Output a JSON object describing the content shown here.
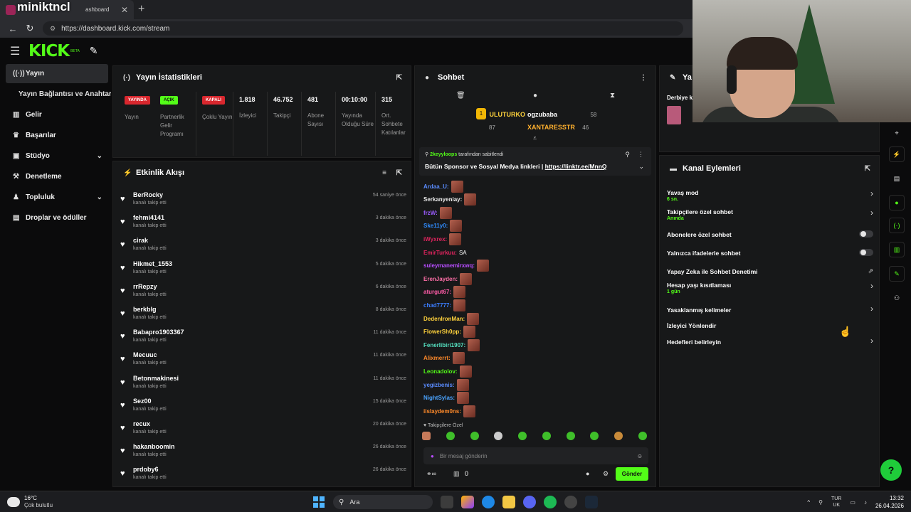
{
  "browser": {
    "overlay_name": "miniktncl",
    "tab_title": "ashboard",
    "tab_close": "✕",
    "new_tab": "+",
    "url": "https://dashboard.kick.com/stream"
  },
  "app": {
    "logo": "KICK",
    "beta": "BETA"
  },
  "nav": {
    "items": [
      {
        "label": "Yayın",
        "icon": "broadcast-icon"
      },
      {
        "label": "Yayın Bağlantısı ve Anahtarı"
      },
      {
        "label": "Gelir",
        "icon": "revenue-icon"
      },
      {
        "label": "Başarılar",
        "icon": "trophy-icon"
      },
      {
        "label": "Stüdyo",
        "icon": "studio-icon"
      },
      {
        "label": "Denetleme",
        "icon": "hammer-icon"
      },
      {
        "label": "Topluluk",
        "icon": "community-icon"
      },
      {
        "label": "Droplar ve ödüller",
        "icon": "drops-icon"
      }
    ]
  },
  "stats": {
    "title": "Yayın İstatistikleri",
    "columns": [
      {
        "badge": "YAYINDA",
        "label": "Yayın"
      },
      {
        "badge": "AÇIK",
        "label": "Partnerlik Gelir Programı"
      },
      {
        "badge": "KAPALI",
        "label": "Çoklu Yayın"
      },
      {
        "value": "1.818",
        "label": "İzleyici"
      },
      {
        "value": "46.752",
        "label": "Takipçi"
      },
      {
        "value": "481",
        "label": "Abone Sayısı"
      },
      {
        "value": "00:10:00",
        "label": "Yayında Olduğu Süre"
      },
      {
        "value": "315",
        "label": "Ort. Sohbete Katılanlar"
      }
    ]
  },
  "activity": {
    "title": "Etkinlik Akışı",
    "sub": "kanalı takip etti",
    "rows": [
      {
        "name": "BerRocky",
        "time": "54 saniye önce"
      },
      {
        "name": "fehmi4141",
        "time": "3 dakika önce"
      },
      {
        "name": "cirak",
        "time": "3 dakika önce"
      },
      {
        "name": "Hikmet_1553",
        "time": "5 dakika önce"
      },
      {
        "name": "rrRepzy",
        "time": "6 dakika önce"
      },
      {
        "name": "berkblg",
        "time": "8 dakika önce"
      },
      {
        "name": "Babapro1903367",
        "time": "11 dakika önce"
      },
      {
        "name": "Mecuuc",
        "time": "11 dakika önce"
      },
      {
        "name": "Betonmakinesi",
        "time": "11 dakika önce"
      },
      {
        "name": "Sez00",
        "time": "15 dakika önce"
      },
      {
        "name": "recux",
        "time": "20 dakika önce"
      },
      {
        "name": "hakanboomin",
        "time": "26 dakika önce"
      },
      {
        "name": "prdoby6",
        "time": "26 dakika önce"
      }
    ]
  },
  "chat": {
    "title": "Sohbet",
    "leaderboard": [
      {
        "name": "ULUTURKO",
        "count": "87"
      },
      {
        "name": "ogzubaba",
        "count": "58"
      },
      {
        "name": "XANTARESSTR",
        "count": "46"
      }
    ],
    "pinned_by": "2keyyloops",
    "pinned_suffix": "tarafından sabitlendi",
    "pinned_text": "Bütün Sponsor ve Sosyal Medya linkleri |",
    "pinned_link": "https://linktr.ee/MnnQ",
    "messages": [
      {
        "user": "Ardaa_U:",
        "color": "#5a8cff"
      },
      {
        "user": "Serkanyeniay:",
        "color": "#e8e8e8"
      },
      {
        "user": "frzW:",
        "color": "#9b5cff"
      },
      {
        "user": "Ske11y0:",
        "color": "#2f8cff"
      },
      {
        "user": "iWyxrex:",
        "color": "#e0245e"
      },
      {
        "user": "EmirTurkuu:",
        "color": "#e0245e",
        "text": "SA"
      },
      {
        "user": "suleymanemirxwq:",
        "color": "#b84dff"
      },
      {
        "user": "ErenJayden:",
        "color": "#ff6fa8"
      },
      {
        "user": "aturgut67:",
        "color": "#ff5ca8"
      },
      {
        "user": "chad7777:",
        "color": "#3b7dff"
      },
      {
        "user": "DedenIronMan:",
        "color": "#ffd23c"
      },
      {
        "user": "FlowerSh0pp:",
        "color": "#ffd23c"
      },
      {
        "user": "Fenerlibiri1907:",
        "color": "#55e0c0"
      },
      {
        "user": "Alixmerrt:",
        "color": "#ff8a2a"
      },
      {
        "user": "Leonadolov:",
        "color": "#53fc18"
      },
      {
        "user": "yegizbenis:",
        "color": "#5a8cff"
      },
      {
        "user": "NightSylas:",
        "color": "#4aa3ff"
      },
      {
        "user": "iislaydem0ns:",
        "color": "#ff8a2a"
      }
    ],
    "followers_only": "Takipçilere Özel",
    "input_placeholder": "Bir mesaj gönderin",
    "count": "0",
    "send_label": "Gönder"
  },
  "right_top": {
    "title": "Ya",
    "sub": "Derbiye k"
  },
  "channel_actions": {
    "title": "Kanal Eylemleri",
    "rows": [
      {
        "label": "Yavaş mod",
        "sub": "6 sn.",
        "control": "arrow"
      },
      {
        "label": "Takipçilere özel sohbet",
        "sub": "Anında",
        "control": "arrow"
      },
      {
        "label": "Abonelere özel sohbet",
        "control": "toggle"
      },
      {
        "label": "Yalnızca ifadelerle sohbet",
        "control": "toggle"
      },
      {
        "label": "Yapay Zeka ile Sohbet Denetimi",
        "control": "external"
      },
      {
        "label": "Hesap yaşı kısıtlaması",
        "sub": "1 gün",
        "control": "arrow"
      },
      {
        "label": "Yasaklanmış kelimeler",
        "control": "arrow"
      },
      {
        "label": "İzleyici Yönlendir",
        "control": "none"
      },
      {
        "label": "Hedefleri belirleyin",
        "control": "arrow"
      }
    ]
  },
  "taskbar": {
    "temp": "16°C",
    "weather": "Çok bulutlu",
    "search": "Ara",
    "lang1": "TUR",
    "lang2": "UK",
    "time": "13:32",
    "date": "26.04.2026"
  },
  "colors": {
    "accent": "#53fc18",
    "live_red": "#d9272e",
    "panel": "#171819"
  }
}
